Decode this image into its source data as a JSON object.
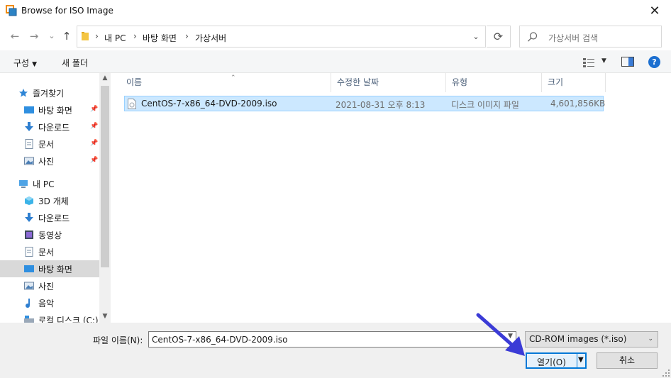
{
  "window": {
    "title": "Browse for ISO Image",
    "close_glyph": "✕"
  },
  "nav": {
    "back_glyph": "←",
    "forward_glyph": "→",
    "recent_glyph": "⌄",
    "up_glyph": "↑",
    "breadcrumbs": [
      "내 PC",
      "바탕 화면",
      "가상서버"
    ],
    "separator": "›",
    "refresh_glyph": "⟳",
    "search_placeholder": "가상서버 검색"
  },
  "toolbar": {
    "organize_label": "구성",
    "new_folder_label": "새 폴더",
    "help_label": "?"
  },
  "sidebar": {
    "items": [
      {
        "label": "즐겨찾기",
        "icon": "star-icon",
        "pinned": false,
        "indent": 1
      },
      {
        "label": "바탕 화면",
        "icon": "desktop-icon",
        "pinned": true,
        "indent": 2
      },
      {
        "label": "다운로드",
        "icon": "download-icon",
        "pinned": true,
        "indent": 2
      },
      {
        "label": "문서",
        "icon": "document-icon",
        "pinned": true,
        "indent": 2
      },
      {
        "label": "사진",
        "icon": "pictures-icon",
        "pinned": true,
        "indent": 2
      },
      {
        "label": "내 PC",
        "icon": "pc-icon",
        "pinned": false,
        "indent": 1
      },
      {
        "label": "3D 개체",
        "icon": "cube-icon",
        "pinned": false,
        "indent": 2
      },
      {
        "label": "다운로드",
        "icon": "download-icon",
        "pinned": false,
        "indent": 2
      },
      {
        "label": "동영상",
        "icon": "video-icon",
        "pinned": false,
        "indent": 2
      },
      {
        "label": "문서",
        "icon": "document-icon",
        "pinned": false,
        "indent": 2
      },
      {
        "label": "바탕 화면",
        "icon": "desktop-icon",
        "pinned": false,
        "indent": 2,
        "selected": true
      },
      {
        "label": "사진",
        "icon": "pictures-icon",
        "pinned": false,
        "indent": 2
      },
      {
        "label": "음악",
        "icon": "music-icon",
        "pinned": false,
        "indent": 2
      },
      {
        "label": "로컬 디스크 (C:)",
        "icon": "drive-icon",
        "pinned": false,
        "indent": 2
      }
    ]
  },
  "filelist": {
    "columns": [
      "이름",
      "수정한 날짜",
      "유형",
      "크기"
    ],
    "files": [
      {
        "name": "CentOS-7-x86_64-DVD-2009.iso",
        "modified": "2021-08-31 오후 8:13",
        "type": "디스크 이미지 파일",
        "size": "4,601,856KB"
      }
    ]
  },
  "bottom": {
    "filename_label": "파일 이름(N):",
    "filename_value": "CentOS-7-x86_64-DVD-2009.iso",
    "filter_value": "CD-ROM images (*.iso)",
    "open_label": "열기(O)",
    "cancel_label": "취소"
  },
  "colors": {
    "accent": "#0078d7",
    "selection": "#cce8ff",
    "annotation_arrow": "#3b3bd6"
  }
}
